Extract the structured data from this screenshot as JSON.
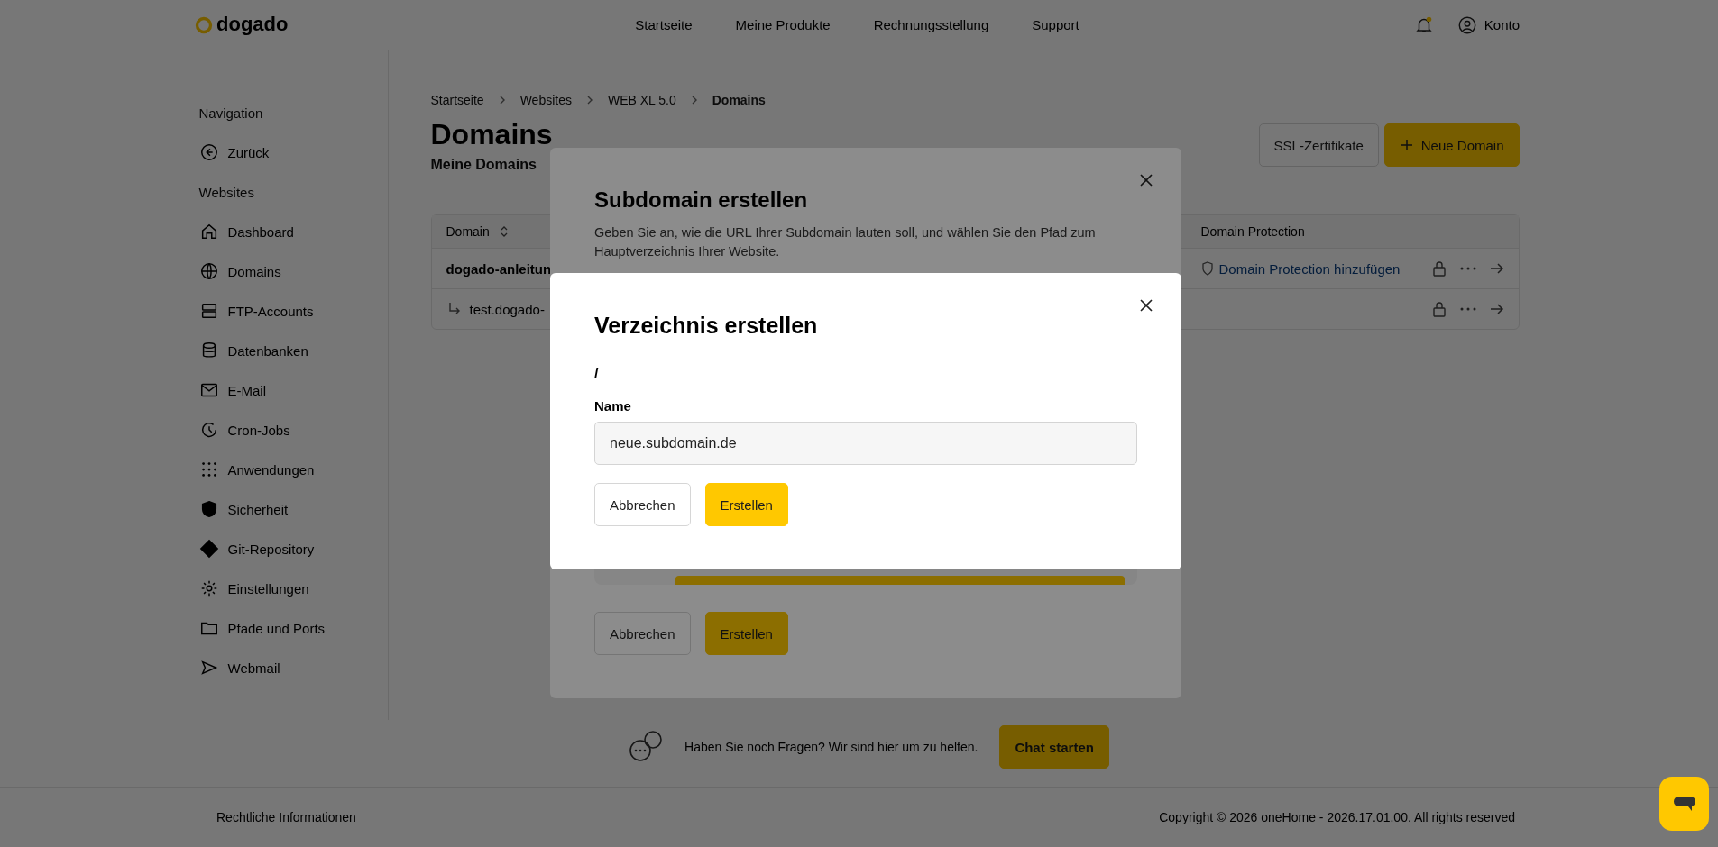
{
  "header": {
    "logo": "dogado",
    "nav": [
      "Startseite",
      "Meine Produkte",
      "Rechnungsstellung",
      "Support"
    ],
    "account": "Konto"
  },
  "sidebar": {
    "sections": [
      {
        "title": "Navigation",
        "items": [
          {
            "label": "Zurück",
            "kind": "back"
          }
        ]
      },
      {
        "title": "Websites",
        "items": [
          {
            "label": "Dashboard",
            "kind": "home"
          },
          {
            "label": "Domains",
            "kind": "globe"
          },
          {
            "label": "FTP-Accounts",
            "kind": "server"
          },
          {
            "label": "Datenbanken",
            "kind": "database"
          },
          {
            "label": "E-Mail",
            "kind": "mail"
          },
          {
            "label": "Cron-Jobs",
            "kind": "clock"
          },
          {
            "label": "Anwendungen",
            "kind": "grid"
          },
          {
            "label": "Sicherheit",
            "kind": "shield"
          },
          {
            "label": "Git-Repository",
            "kind": "git"
          },
          {
            "label": "Einstellungen",
            "kind": "gear"
          },
          {
            "label": "Pfade und Ports",
            "kind": "folder"
          },
          {
            "label": "Webmail",
            "kind": "send"
          }
        ]
      }
    ]
  },
  "breadcrumb": [
    "Startseite",
    "Websites",
    "WEB XL 5.0",
    "Domains"
  ],
  "page": {
    "title": "Domains",
    "subtitle": "Meine Domains",
    "actions": [
      {
        "label": "SSL-Zertifikate",
        "kind": "secondary"
      },
      {
        "label": "Neue Domain",
        "kind": "primary"
      }
    ]
  },
  "table": {
    "columns": [
      "Domain",
      "Domain Protection"
    ],
    "rows": [
      {
        "domain": "dogado-anleitun",
        "subdomain": false,
        "protection": "Domain Protection hinzufügen"
      },
      {
        "domain": "test.dogado-",
        "subdomain": true
      }
    ]
  },
  "help": {
    "text": "Haben Sie noch Fragen? Wir sind hier um zu helfen.",
    "button": "Chat starten"
  },
  "footer": {
    "legal": "Rechtliche Informationen",
    "copyright": "Copyright © 2026 oneHome - 2026.17.01.00. All rights reserved"
  },
  "subdomain_dialog": {
    "title": "Subdomain erstellen",
    "description": "Geben Sie an, wie die URL Ihrer Subdomain lauten soll, und wählen Sie den Pfad zum Hauptverzeichnis Ihrer Website.",
    "buttons": [
      {
        "label": "Abbrechen",
        "kind": "secondary"
      },
      {
        "label": "Erstellen",
        "kind": "primary"
      }
    ]
  },
  "directory_dialog": {
    "title": "Verzeichnis erstellen",
    "path": "/",
    "field": {
      "label": "Name",
      "value": "neue.subdomain.de"
    },
    "buttons": [
      {
        "label": "Abbrechen",
        "kind": "secondary"
      },
      {
        "label": "Erstellen",
        "kind": "primary"
      }
    ]
  }
}
